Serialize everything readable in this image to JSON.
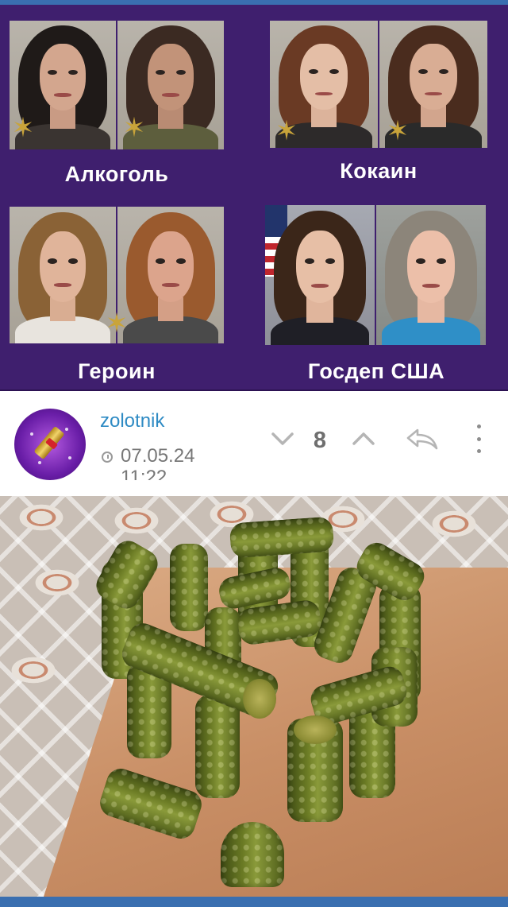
{
  "meme": {
    "captions": {
      "alcohol": "Алкоголь",
      "cocaine": "Кокаин",
      "heroin": "Героин",
      "state_dept": "Госдеп США"
    }
  },
  "post": {
    "username": "zolotnik",
    "date": "07.05.24",
    "time": "11:22",
    "vote_count": "8"
  },
  "icons": {
    "vote_down": "chevron-down-icon",
    "vote_up": "chevron-up-icon",
    "reply": "reply-arrow-icon",
    "more": "more-vertical-icon",
    "clock": "clock-icon"
  },
  "colors": {
    "meme_background": "#3f1f6e",
    "username": "#2f8bc4",
    "muted_text": "#777777",
    "icon_gray": "#b5b5b5",
    "accent_strip": "#3a6fb0"
  }
}
